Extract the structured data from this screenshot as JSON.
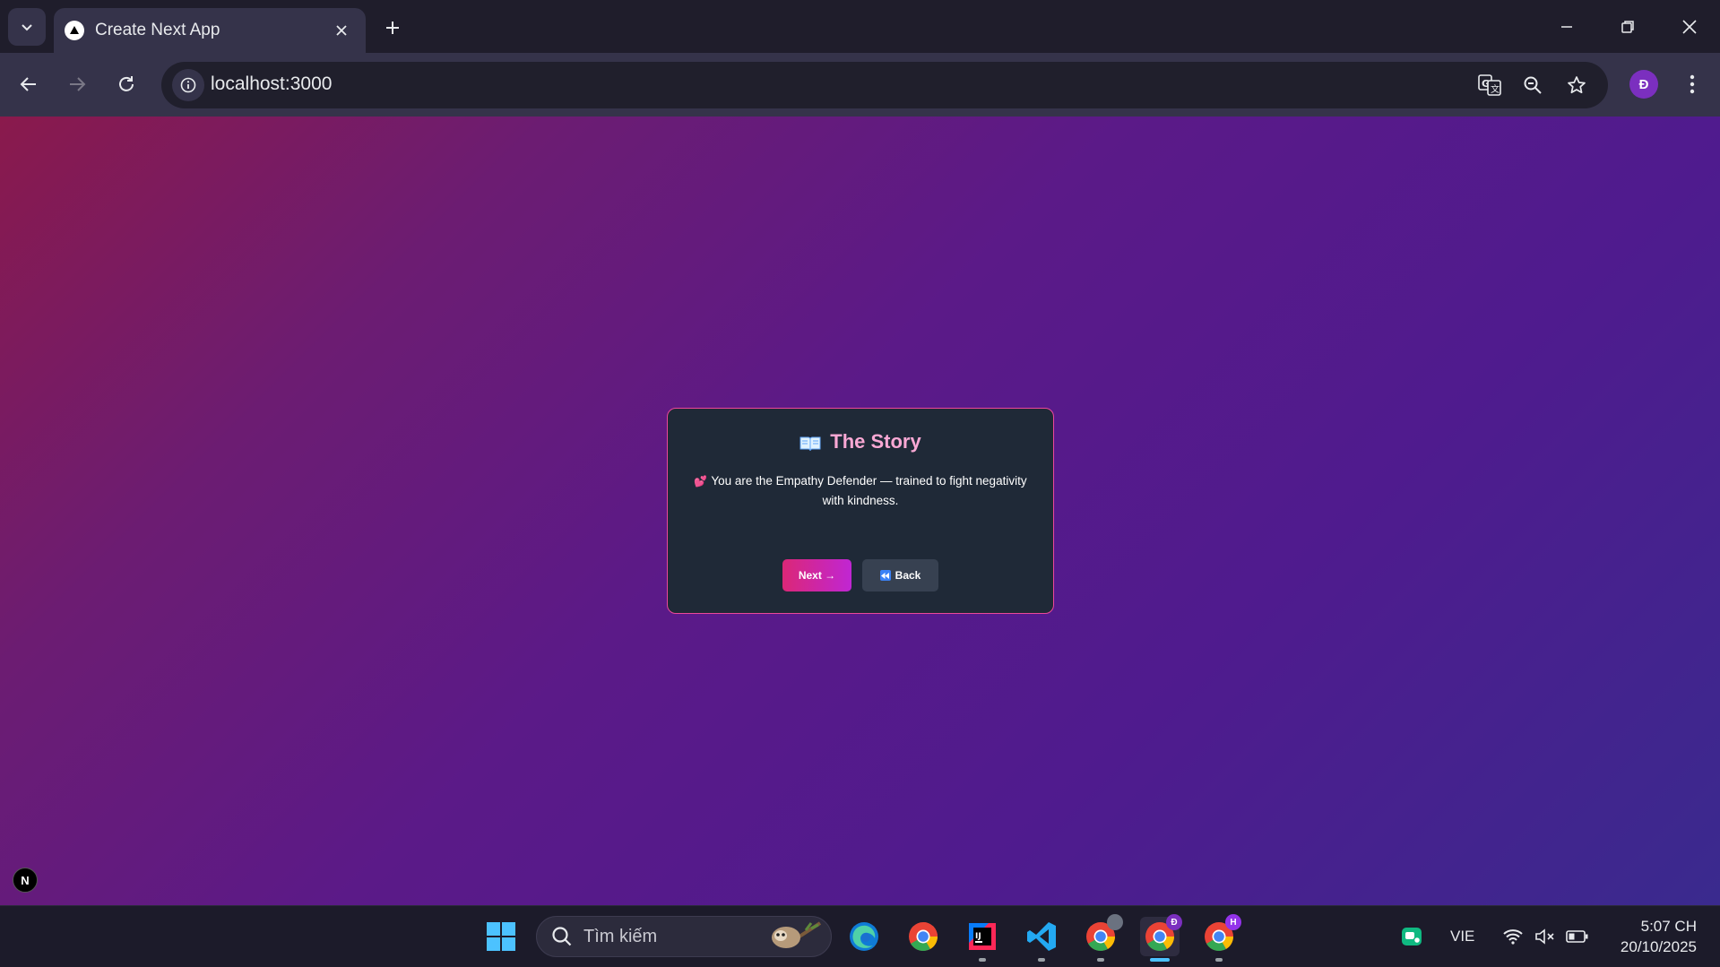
{
  "browser": {
    "tab_title": "Create Next App",
    "url": "localhost:3000",
    "profile_initial": "Đ"
  },
  "card": {
    "title": "The Story",
    "text": "You are the Empathy Defender — trained to fight negativity with kindness.",
    "next_label": "Next →",
    "back_label": "Back"
  },
  "page": {
    "next_badge": "N"
  },
  "taskbar": {
    "search_placeholder": "Tìm kiếm",
    "language": "VIE",
    "time": "5:07 CH",
    "date": "20/10/2025",
    "chrome_badge_1": "Đ",
    "chrome_badge_2": "H"
  },
  "icons": {
    "card_title_icon": "open-book-icon",
    "card_text_icon": "heart-icon",
    "back_icon": "rewind-icon"
  },
  "colors": {
    "accent_pink": "#ec4899",
    "title_pink": "#f9a8d4",
    "card_bg": "#1f2937"
  }
}
